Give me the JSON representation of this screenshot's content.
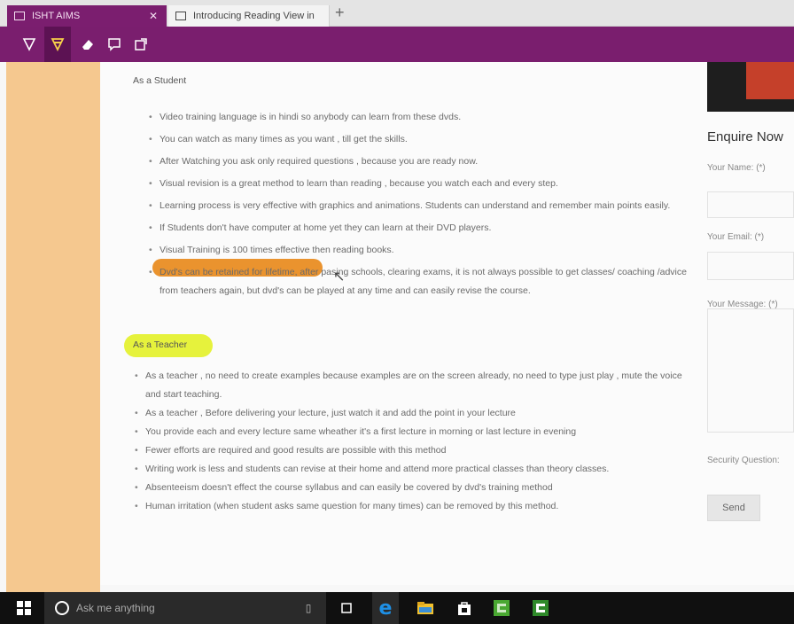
{
  "browser": {
    "tabs": [
      {
        "title": "ISHT AIMS",
        "active": true
      },
      {
        "title": "Introducing Reading View in",
        "active": false
      }
    ],
    "close_glyph": "✕",
    "newtab_glyph": "+"
  },
  "toolbar": {
    "tools": [
      "pen-icon",
      "highlighter-icon",
      "eraser-icon",
      "comment-icon",
      "clip-icon"
    ],
    "color": "#7a1e6e"
  },
  "article": {
    "student_heading": "As a Student",
    "student_points": [
      "Video training language is in hindi so anybody can learn from these dvds.",
      "You can watch as many times as you want , till get the skills.",
      "After Watching you ask only required questions , because you are ready now.",
      "Visual revision is a great method to learn than reading , because you watch each and every step.",
      "Learning process is very effective with graphics and animations. Students can understand and remember main points easily.",
      "If Students don't have computer at home yet they can learn at their DVD players.",
      "Visual Training is 100 times effective then reading books.",
      "Dvd's can be retained for lifetime, after pasing schools, clearing exams, it is not always possible to get classes/ coaching /advice from teachers again, but dvd's can be played at any time and can easily revise the course."
    ],
    "teacher_heading": "As a Teacher",
    "teacher_points": [
      "As a teacher , no need to create examples because examples are on the screen already, no need to type just play , mute the voice and start teaching.",
      "As a teacher , Before delivering your lecture, just watch it and add the point in your lecture",
      "You provide each and every lecture same wheather it's a first lecture in morning or last lecture in evening",
      "Fewer efforts are required and good results are possible with this method",
      "Writing work is less and students can revise at their home and attend more practical classes than theory classes.",
      "Absenteeism doesn't effect the course syllabus and can easily be covered by dvd's training method",
      "Human irritation (when student asks same question for many times) can be removed by this method."
    ]
  },
  "sidebar": {
    "enquire_title": "Enquire Now",
    "name_label": "Your Name: (*)",
    "email_label": "Your Email: (*)",
    "message_label": "Your Message: (*)",
    "security_label": "Security Question:",
    "send_label": "Send"
  },
  "taskbar": {
    "search_placeholder": "Ask me anything",
    "apps": [
      "windows-start-icon",
      "mic-icon",
      "task-view-icon",
      "edge-icon",
      "file-explorer-icon",
      "store-icon",
      "camtasia-icon",
      "camtasia-recorder-icon"
    ]
  },
  "colors": {
    "tab_active": "#7b1e6f",
    "left_panel": "#f5c88f",
    "highlight_yellow": "#e6f23c",
    "highlight_orange": "#e88a1c",
    "edge_blue": "#1e90e6"
  }
}
